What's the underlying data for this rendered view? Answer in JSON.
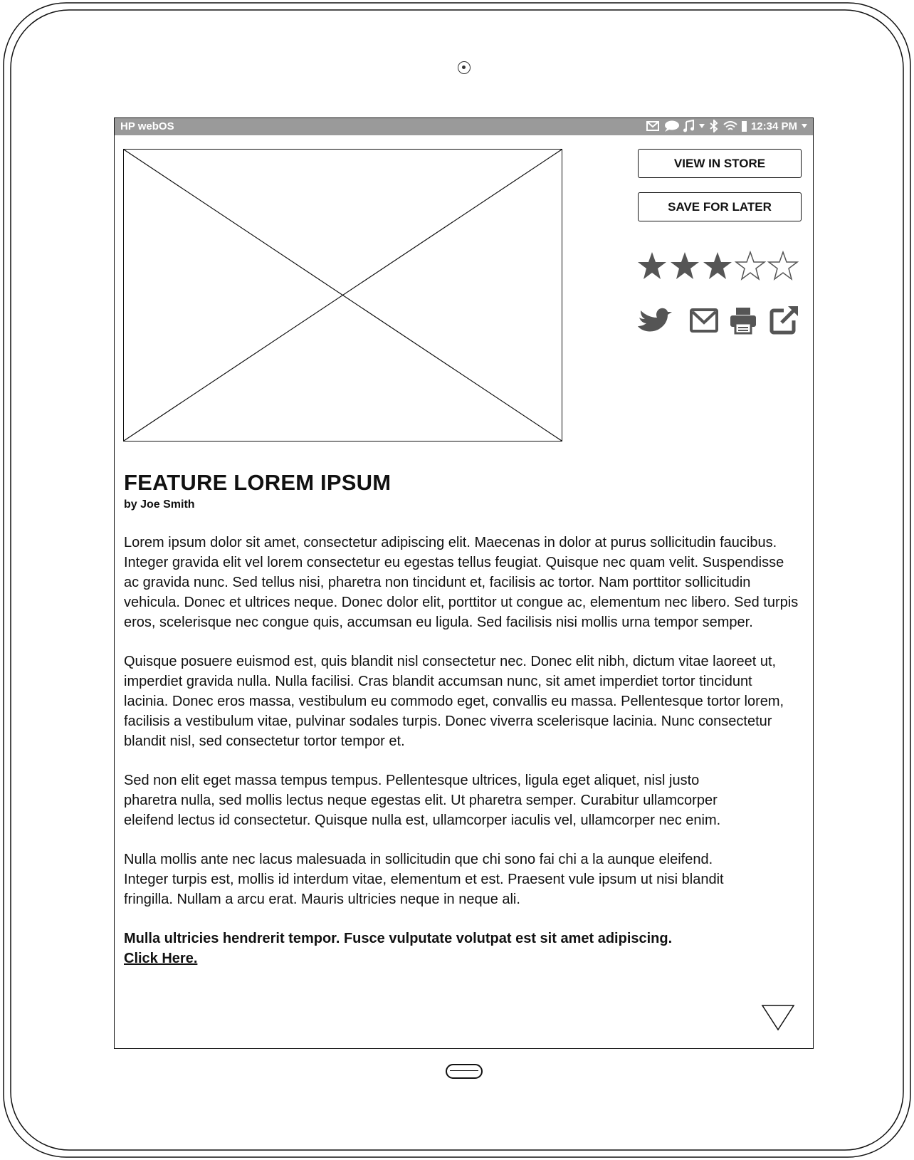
{
  "statusbar": {
    "os_name": "HP webOS",
    "time": "12:34 PM",
    "icons": [
      "mail-icon",
      "chat-icon",
      "music-icon",
      "bluetooth-icon",
      "wifi-icon",
      "battery-icon"
    ]
  },
  "actions": {
    "view_in_store": "VIEW IN STORE",
    "save_for_later": "SAVE FOR LATER"
  },
  "rating": {
    "value": 3,
    "max": 5
  },
  "share": [
    "twitter-icon",
    "email-icon",
    "print-icon",
    "external-link-icon"
  ],
  "article": {
    "title": "FEATURE LOREM IPSUM",
    "byline": "by Joe Smith",
    "paragraphs": [
      "Lorem ipsum dolor sit amet, consectetur adipiscing elit. Maecenas in dolor at purus sollicitudin faucibus. Integer gravida elit vel lorem consectetur eu egestas tellus feugiat. Quisque nec quam velit. Suspendisse ac gravida nunc. Sed tellus nisi, pharetra non tincidunt et, facilisis ac tortor. Nam porttitor sollicitudin vehicula. Donec et ultrices neque. Donec dolor elit, porttitor ut congue ac, elementum nec libero. Sed turpis eros, scelerisque nec congue quis, accumsan eu ligula. Sed facilisis nisi mollis urna tempor semper.",
      "Quisque posuere euismod est, quis blandit nisl consectetur nec. Donec elit nibh, dictum vitae laoreet ut, imperdiet gravida nulla. Nulla facilisi. Cras blandit accumsan nunc, sit amet imperdiet tortor tincidunt lacinia. Donec eros massa, vestibulum eu commodo eget, convallis eu massa. Pellentesque tortor lorem, facilisis a vestibulum vitae, pulvinar sodales turpis. Donec viverra scelerisque lacinia. Nunc consectetur blandit nisl, sed consectetur tortor tempor et.",
      "Sed non elit eget massa tempus tempus. Pellentesque ultrices, ligula eget aliquet, nisl justo pharetra nulla, sed mollis lectus neque egestas elit. Ut pharetra semper. Curabitur ullamcorper eleifend lectus id consectetur. Quisque nulla est, ullamcorper iaculis vel, ullamcorper nec enim.",
      "Nulla mollis ante nec lacus malesuada in sollicitudin que chi sono fai chi a la aunque eleifend. Integer turpis est, mollis id interdum vitae, elementum et est. Praesent vule ipsum ut nisi blandit fringilla. Nullam a arcu erat. Mauris ultricies neque in neque ali."
    ],
    "cta_text": "Mulla ultricies hendrerit tempor. Fusce vulputate volutpat est sit amet adipiscing.",
    "cta_link": "Click Here."
  }
}
